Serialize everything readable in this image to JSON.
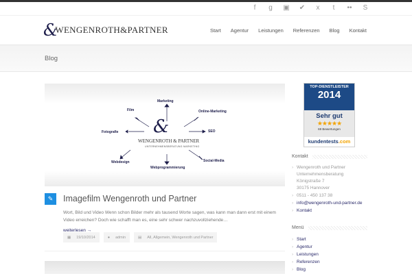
{
  "social_icons": [
    "facebook-icon",
    "google-plus-icon",
    "youtube-icon",
    "twitter-icon",
    "xing-icon",
    "tumblr-icon",
    "flickr-icon",
    "skype-icon"
  ],
  "social_glyphs": [
    "f",
    "g",
    "▣",
    "✔",
    "x",
    "t",
    "••",
    "S"
  ],
  "logo": {
    "text": "WENGENROTH&PARTNER"
  },
  "nav": [
    "Start",
    "Agentur",
    "Leistungen",
    "Referenzen",
    "Blog",
    "Kontakt"
  ],
  "page_title": "Blog",
  "diagram": {
    "center": "WENGENROTH & PARTNER",
    "subtitle": "UNTERNEHMENSBERATUNG MARKETING",
    "labels": [
      "Marketing",
      "Film",
      "Online-Marketing",
      "Fotografie",
      "SEO",
      "Webdesign",
      "Webprogrammierung",
      "Social-Media"
    ]
  },
  "post": {
    "title": "Imagefilm Wengenroth und Partner",
    "excerpt": "Wort, Bild und Video Wenn schon Bilder mehr als tausend Worte sagen, was kann man dann erst mit einem Video erreichen? Doch wie schafft man es, eine sehr schwer nachzuvollziehende…",
    "read_more": "weiterlesen →",
    "date": "19/10/2014",
    "author": "admin",
    "categories": "All, Allgemein, Wengenroth und Partner"
  },
  "badge": {
    "top": "TOP-DIENSTLEISTER",
    "year": "2014",
    "rating": "Sehr gut",
    "stars": "★★★★★",
    "reviews": "69 Bewertungen",
    "brand": "kundentests",
    "brand_tld": ".com"
  },
  "kontakt": {
    "title": "Kontakt",
    "lines": [
      "Wengenroth und Partner",
      "Unternehmensberatung",
      "Königstraße 7",
      "30175 Hannover"
    ],
    "phone": "0511 - 450 137 38",
    "email": "info@wengenroth-und-partner.de",
    "link": "Kontakt"
  },
  "menu": {
    "title": "Menü",
    "items": [
      "Start",
      "Agentur",
      "Leistungen",
      "Referenzen",
      "Blog"
    ]
  }
}
